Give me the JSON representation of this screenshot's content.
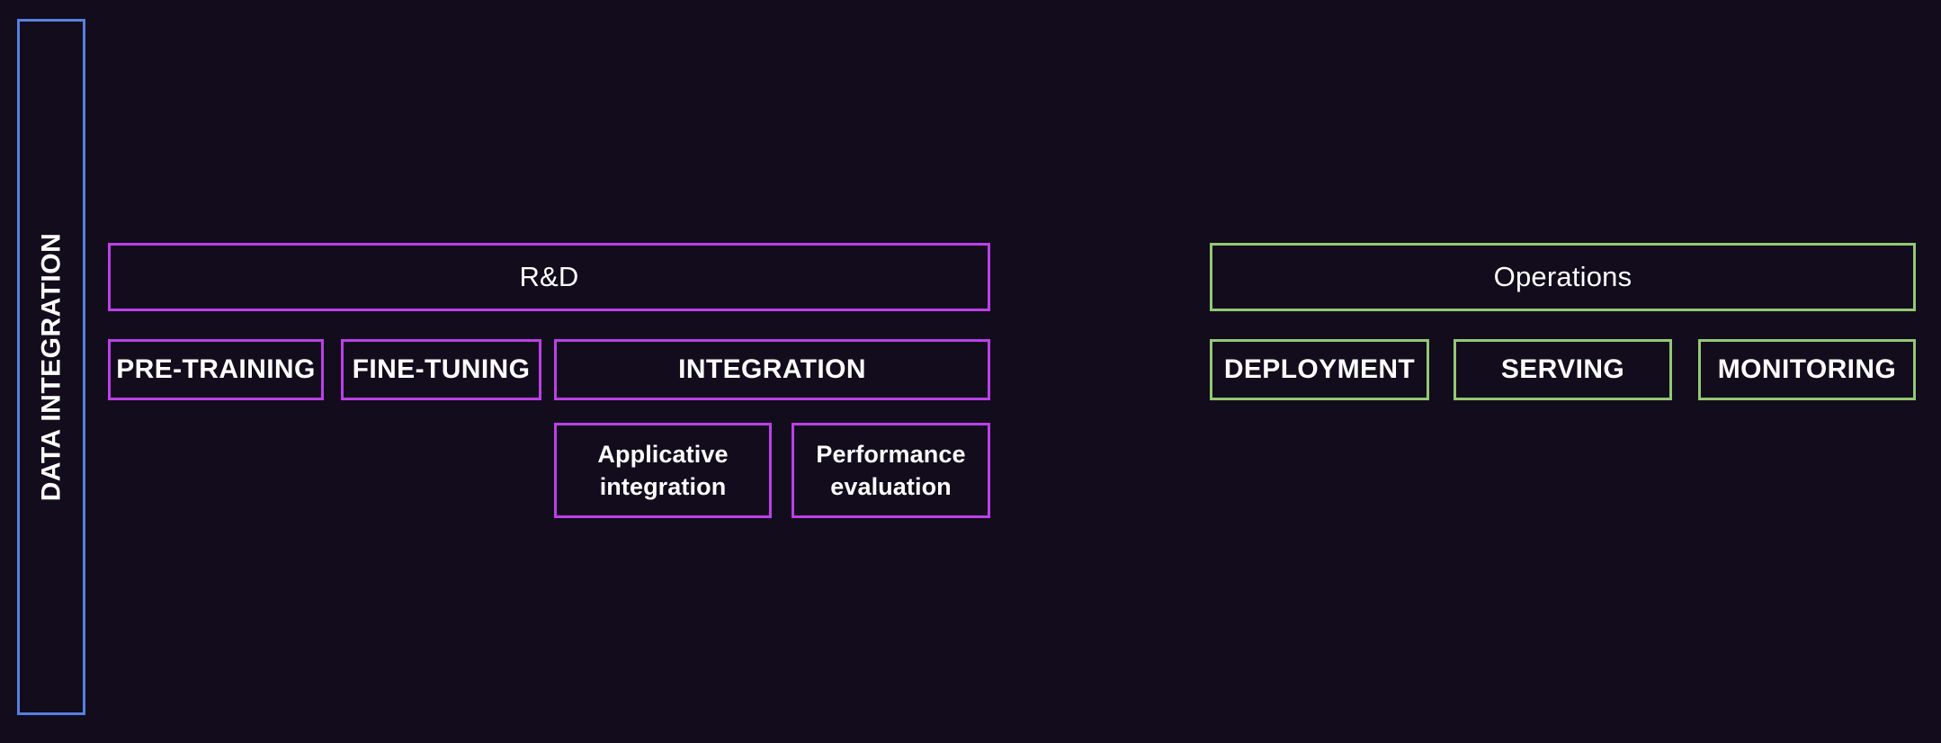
{
  "diagram": {
    "title_text_colors": {
      "background": "#120c1c",
      "text": "#ffffff",
      "accent_blue": "#5580e0",
      "accent_purple": "#bd3fe8",
      "accent_green": "#92c972"
    },
    "sidebar": {
      "label": "DATA INTEGRATION",
      "color": "#5580e0"
    },
    "lanes": [
      {
        "id": "rnd",
        "header": "R&D",
        "color": "#bd3fe8",
        "stages": [
          {
            "id": "pre-training",
            "label": "PRE-TRAINING"
          },
          {
            "id": "fine-tuning",
            "label": "FINE-TUNING"
          },
          {
            "id": "integration",
            "label": "INTEGRATION"
          }
        ],
        "tasks": [
          {
            "id": "applicative-integration",
            "line1": "Applicative",
            "line2": "integration"
          },
          {
            "id": "performance-evaluation",
            "line1": "Performance",
            "line2": "evaluation"
          }
        ]
      },
      {
        "id": "operations",
        "header": "Operations",
        "color": "#92c972",
        "stages": [
          {
            "id": "deployment",
            "label": "DEPLOYMENT"
          },
          {
            "id": "serving",
            "label": "SERVING"
          },
          {
            "id": "monitoring",
            "label": "MONITORING"
          }
        ],
        "tasks": []
      }
    ]
  }
}
